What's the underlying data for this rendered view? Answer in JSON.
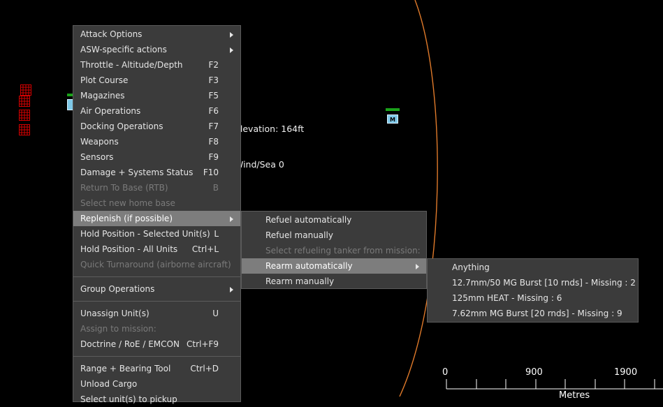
{
  "map": {
    "elevation_text": "Elevation: 164ft",
    "wind_sea_text": "Wind/Sea 0",
    "unit_m_label": "M",
    "accent_orange": "#e07a2a",
    "friendly_green": "#1aa21a",
    "hostile_red": "#d40000"
  },
  "scale": {
    "labels": [
      "0",
      "900",
      "1900"
    ],
    "unit": "Metres"
  },
  "context_menu": {
    "items": [
      {
        "label": "Attack Options",
        "shortcut": "",
        "submenu": true,
        "disabled": false
      },
      {
        "label": "ASW-specific actions",
        "shortcut": "",
        "submenu": true,
        "disabled": false
      },
      {
        "label": "Throttle - Altitude/Depth",
        "shortcut": "F2",
        "submenu": false,
        "disabled": false
      },
      {
        "label": "Plot Course",
        "shortcut": "F3",
        "submenu": false,
        "disabled": false
      },
      {
        "label": "Magazines",
        "shortcut": "F5",
        "submenu": false,
        "disabled": false
      },
      {
        "label": "Air Operations",
        "shortcut": "F6",
        "submenu": false,
        "disabled": false
      },
      {
        "label": "Docking Operations",
        "shortcut": "F7",
        "submenu": false,
        "disabled": false
      },
      {
        "label": "Weapons",
        "shortcut": "F8",
        "submenu": false,
        "disabled": false
      },
      {
        "label": "Sensors",
        "shortcut": "F9",
        "submenu": false,
        "disabled": false
      },
      {
        "label": "Damage + Systems Status",
        "shortcut": "F10",
        "submenu": false,
        "disabled": false
      },
      {
        "label": "Return To Base (RTB)",
        "shortcut": "B",
        "submenu": false,
        "disabled": true
      },
      {
        "label": "Select new home base",
        "shortcut": "",
        "submenu": false,
        "disabled": true
      },
      {
        "label": "Replenish (if possible)",
        "shortcut": "",
        "submenu": true,
        "disabled": false,
        "active": true
      },
      {
        "label": "Hold Position - Selected Unit(s)",
        "shortcut": "L",
        "submenu": false,
        "disabled": false
      },
      {
        "label": "Hold Position - All Units",
        "shortcut": "Ctrl+L",
        "submenu": false,
        "disabled": false
      },
      {
        "label": "Quick Turnaround (airborne aircraft)",
        "shortcut": "",
        "submenu": false,
        "disabled": true
      },
      {
        "label": "Group Operations",
        "shortcut": "",
        "submenu": true,
        "disabled": false
      },
      {
        "label": "Unassign Unit(s)",
        "shortcut": "U",
        "submenu": false,
        "disabled": false
      },
      {
        "label": "Assign to mission:",
        "shortcut": "",
        "submenu": false,
        "disabled": true
      },
      {
        "label": "Doctrine / RoE / EMCON",
        "shortcut": "Ctrl+F9",
        "submenu": false,
        "disabled": false
      },
      {
        "label": "Range + Bearing Tool",
        "shortcut": "Ctrl+D",
        "submenu": false,
        "disabled": false
      },
      {
        "label": "Unload Cargo",
        "shortcut": "",
        "submenu": false,
        "disabled": false
      },
      {
        "label": "Select unit(s) to pickup",
        "shortcut": "",
        "submenu": false,
        "disabled": false
      }
    ]
  },
  "replenish_menu": {
    "items": [
      {
        "label": "Refuel automatically",
        "submenu": false,
        "disabled": false
      },
      {
        "label": "Refuel manually",
        "submenu": false,
        "disabled": false
      },
      {
        "label": "Select refueling tanker from mission:",
        "submenu": false,
        "disabled": true
      },
      {
        "label": "Rearm automatically",
        "submenu": true,
        "disabled": false,
        "active": true
      },
      {
        "label": "Rearm manually",
        "submenu": false,
        "disabled": false
      }
    ]
  },
  "rearm_menu": {
    "items": [
      {
        "label": "Anything"
      },
      {
        "label": "12.7mm/50 MG Burst [10 rnds] - Missing : 2"
      },
      {
        "label": "125mm HEAT - Missing : 6"
      },
      {
        "label": "7.62mm MG Burst [20 rnds] - Missing : 9"
      }
    ]
  }
}
